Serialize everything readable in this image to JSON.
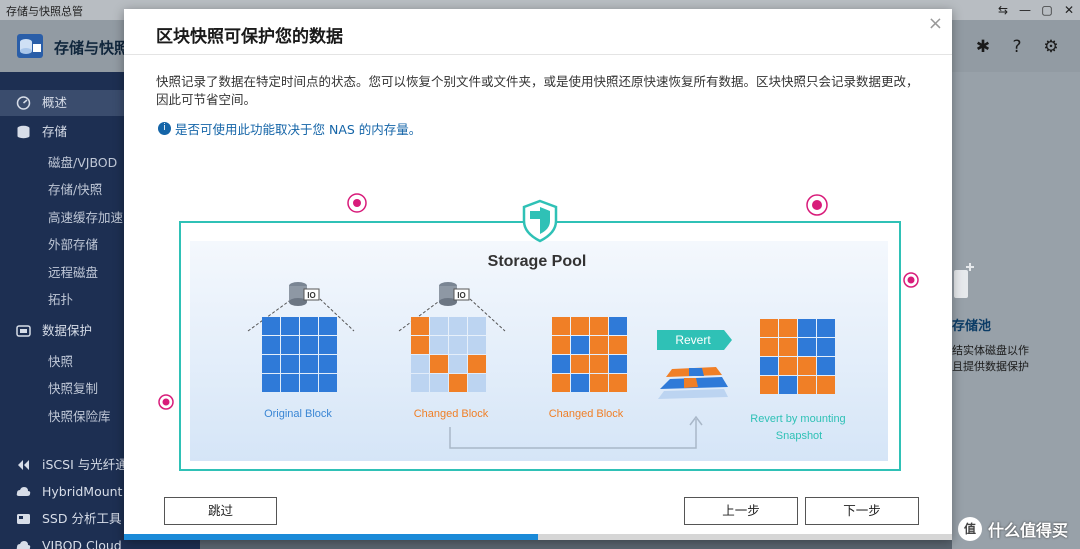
{
  "window": {
    "title": "存储与快照总管",
    "controls": [
      "⇆",
      "—",
      "▢",
      "✕"
    ]
  },
  "app": {
    "title": "存储与快照"
  },
  "sidebar": {
    "overview": "概述",
    "storage": "存储",
    "storage_items": [
      "磁盘/VJBOD",
      "存储/快照",
      "高速缓存加速",
      "外部存储",
      "远程磁盘",
      "拓扑"
    ],
    "protection": "数据保护",
    "protection_items": [
      "快照",
      "快照复制",
      "快照保险库"
    ],
    "iscsi": "iSCSI 与光纤通",
    "hybridmount": "HybridMount",
    "ssd": "SSD 分析工具",
    "vjbod": "VJBOD Cloud"
  },
  "right_pane": {
    "title": "存储池",
    "line1": "结实体磁盘以作",
    "line2": "且提供数据保护"
  },
  "watermark": {
    "badge": "值",
    "text": "什么值得买"
  },
  "modal": {
    "title": "区块快照可保护您的数据",
    "close": "×",
    "description": "快照记录了数据在特定时间点的状态。您可以恢复个别文件或文件夹，或是使用快照还原快速恢复所有数据。区块快照只会记录数据更改，因此可节省空间。",
    "tip": "是否可使用此功能取决于您 NAS 的内存量。",
    "tip_icon": "i",
    "buttons": {
      "skip": "跳过",
      "prev": "上一步",
      "next": "下一步"
    },
    "progress_percent": 50
  },
  "diagram": {
    "title": "Storage Pool",
    "io_label": "IO",
    "revert_label": "Revert",
    "labels": {
      "original": "Original Block",
      "changed1": "Changed Block",
      "changed2": "Changed Block",
      "revert_line1": "Revert by mounting",
      "revert_line2": "Snapshot"
    },
    "colors": {
      "blue": "#2f7ad8",
      "light_blue": "#bcd4f1",
      "orange": "#f07f26",
      "teal": "#2fc1b6",
      "label_blue": "#3a86d4",
      "label_orange": "#f07f26",
      "bug": "#d81b7a"
    },
    "grids": {
      "original": [
        "BBBB",
        "BBBB",
        "BBBB",
        "BBBB"
      ],
      "changed1": [
        "OLLL",
        "OLLL",
        "LOLO",
        "LLOL"
      ],
      "changed2": [
        "OOOB",
        "OBOO",
        "BOOB",
        "OBOO"
      ],
      "revert": [
        "OOBB",
        "OOBB",
        "BOOB",
        "OBOO"
      ]
    }
  }
}
